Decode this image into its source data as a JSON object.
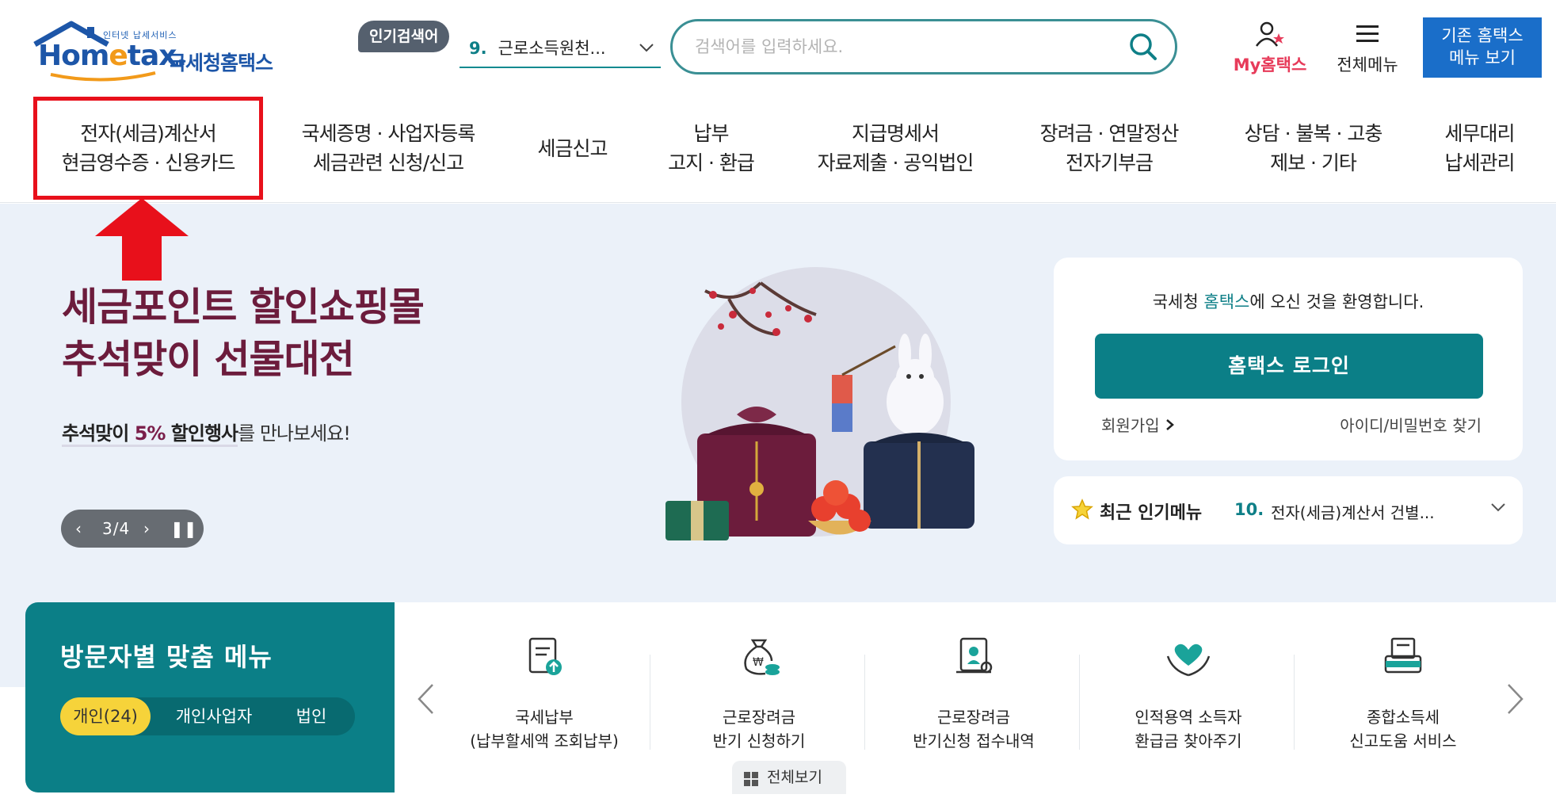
{
  "header": {
    "logo_small": "인터넷 납세서비스",
    "logo_brand_a": "Hom",
    "logo_brand_e": "e",
    "logo_brand_b": "tax.",
    "logo_sub": "국세청홈택스",
    "popular_tag": "인기검색어",
    "popular_num": "9.",
    "popular_value": "근로소득원천...",
    "search_placeholder": "검색어를 입력하세요.",
    "my_hometax": "My홈택스",
    "all_menu": "전체메뉴",
    "old_btn_line1": "기존 홈택스",
    "old_btn_line2": "메뉴 보기"
  },
  "nav": {
    "items": [
      {
        "l1": "전자(세금)계산서",
        "l2": "현금영수증 · 신용카드"
      },
      {
        "l1": "국세증명 · 사업자등록",
        "l2": "세금관련 신청/신고"
      },
      {
        "l1": "세금신고",
        "l2": ""
      },
      {
        "l1": "납부",
        "l2": "고지 · 환급"
      },
      {
        "l1": "지급명세서",
        "l2": "자료제출 · 공익법인"
      },
      {
        "l1": "장려금 · 연말정산",
        "l2": "전자기부금"
      },
      {
        "l1": "상담 · 불복 · 고충",
        "l2": "제보 · 기타"
      },
      {
        "l1": "세무대리",
        "l2": "납세관리"
      }
    ]
  },
  "hero": {
    "title_line1": "세금포인트 할인쇼핑몰",
    "title_line2": "추석맞이 선물대전",
    "sub_a": "추석맞이 ",
    "sub_pct": "5%",
    "sub_b": " 할인행사",
    "sub_c": "를 만나보세요!",
    "pager": "3/4"
  },
  "login": {
    "welcome_a": "국세청 ",
    "welcome_hl": "홈택스",
    "welcome_b": "에 오신 것을 환영합니다.",
    "login_btn": "홈택스 로그인",
    "signup": "회원가입",
    "find": "아이디/비밀번호 찾기"
  },
  "recent": {
    "title": "최근 인기메뉴",
    "num": "10.",
    "value": "전자(세금)계산서 건별..."
  },
  "visitor": {
    "title": "방문자별 맞춤 메뉴",
    "tabs": [
      "개인(24)",
      "개인사업자",
      "법인"
    ]
  },
  "services": {
    "items": [
      {
        "l1": "국세납부",
        "l2": "(납부할세액 조회납부)",
        "icon": "tax-document-icon"
      },
      {
        "l1": "근로장려금",
        "l2": "반기 신청하기",
        "icon": "money-bag-icon"
      },
      {
        "l1": "근로장려금",
        "l2": "반기신청 접수내역",
        "icon": "certificate-scroll-icon"
      },
      {
        "l1": "인적용역 소득자",
        "l2": "환급금 찾아주기",
        "icon": "heart-hands-icon"
      },
      {
        "l1": "종합소득세",
        "l2": "신고도움 서비스",
        "icon": "printer-tray-icon"
      }
    ],
    "see_all": "전체보기"
  },
  "colors": {
    "brand_teal": "#0b7f87",
    "brand_blue": "#1d56a8",
    "highlight_red": "#e8101b",
    "my_pink": "#e73b5a",
    "tab_yellow": "#f6d33a"
  }
}
